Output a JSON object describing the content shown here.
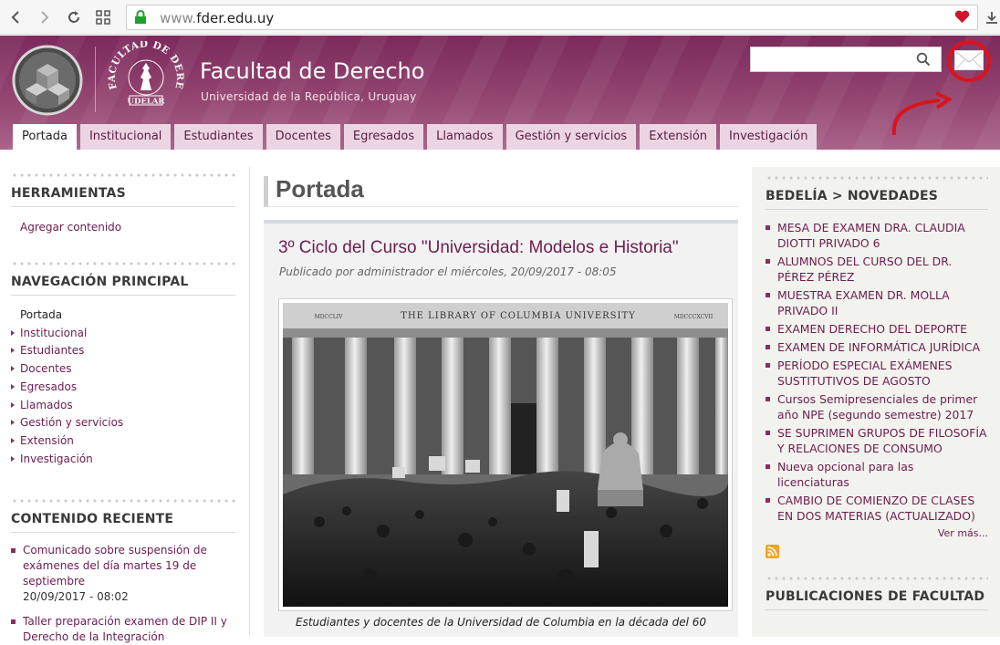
{
  "browser": {
    "url_prefix": "www.",
    "url_domain": "fder.edu.uy"
  },
  "site": {
    "title": "Facultad de Derecho",
    "subtitle": "Universidad de la República, Uruguay",
    "seal_top_text": "FACULTAD DE DERECHO",
    "seal_bottom_text": "UDELAR"
  },
  "menu": [
    {
      "label": "Portada",
      "active": true
    },
    {
      "label": "Institucional"
    },
    {
      "label": "Estudiantes"
    },
    {
      "label": "Docentes"
    },
    {
      "label": "Egresados"
    },
    {
      "label": "Llamados"
    },
    {
      "label": "Gestión y servicios"
    },
    {
      "label": "Extensión"
    },
    {
      "label": "Investigación"
    }
  ],
  "left": {
    "tools_title": "HERRAMIENTAS",
    "tools_link": "Agregar contenido",
    "nav_title": "NAVEGACIÓN PRINCIPAL",
    "nav_items": [
      "Portada",
      "Institucional",
      "Estudiantes",
      "Docentes",
      "Egresados",
      "Llamados",
      "Gestión y servicios",
      "Extensión",
      "Investigación"
    ],
    "recent_title": "CONTENIDO RECIENTE",
    "recent_items": [
      {
        "title": "Comunicado sobre suspensión de exámenes del día martes 19 de septiembre",
        "date": "20/09/2017 - 08:02"
      },
      {
        "title": "Taller preparación examen de DIP II y Derecho de la Integración",
        "date": ""
      }
    ]
  },
  "center": {
    "page_title": "Portada",
    "article_title": "3º Ciclo del Curso \"Universidad: Modelos e Historia\"",
    "article_meta": "Publicado por administrador el miércoles, 20/09/2017 - 08:05",
    "photo_inscription": "THE LIBRARY OF COLUMBIA UNIVERSITY",
    "photo_left_numeral": "MDCCLIV",
    "photo_right_numeral": "MDCCCXCVII",
    "caption": "Estudiantes y docentes de la Universidad de Columbia en la década del 60"
  },
  "right": {
    "news_title": "BEDELÍA > NOVEDADES",
    "news_items": [
      "MESA DE EXAMEN DRA. CLAUDIA DIOTTI PRIVADO 6",
      "ALUMNOS DEL CURSO DEL DR. PÉREZ PÉREZ",
      "MUESTRA EXAMEN DR. MOLLA PRIVADO II",
      "EXAMEN DERECHO DEL DEPORTE",
      "EXAMEN DE INFORMÁTICA JURÍDICA",
      "PERÍODO ESPECIAL EXÁMENES SUSTITUTIVOS DE AGOSTO",
      "Cursos Semipresenciales de primer año NPE (segundo semestre) 2017",
      "SE SUPRIMEN GRUPOS DE FILOSOFÍA Y RELACIONES DE CONSUMO",
      "Nueva opcional para las licenciaturas",
      "CAMBIO DE COMIENZO DE CLASES EN DOS MATERIAS (ACTUALIZADO)"
    ],
    "more_label": "Ver más...",
    "pubs_title": "PUBLICACIONES DE FACULTAD"
  },
  "colors": {
    "brand": "#8a2d62",
    "link": "#6b1d4c",
    "annotation": "#d9141b"
  }
}
